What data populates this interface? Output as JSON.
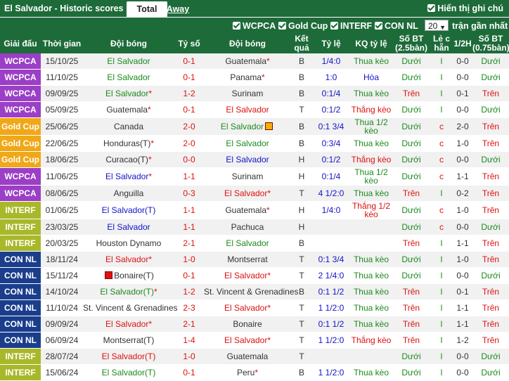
{
  "header": {
    "title": "El Salvador - Historic scores",
    "tab_total": "Total",
    "tab_away": "Away",
    "show_notes": "Hiển thị ghi chú"
  },
  "filters": {
    "items": [
      "WCPCA",
      "Gold Cup",
      "INTERF",
      "CON NL"
    ],
    "count": "20",
    "count_suffix": "trận gần nhất"
  },
  "columns": [
    "Giải đấu",
    "Thời gian",
    "Đội bóng",
    "Tỷ số",
    "Đội bóng",
    "Kết quả",
    "Tỷ lệ",
    "KQ tỷ lệ",
    "Số BT (2.5bàn)",
    "Lẻ c hẵn",
    "1/2H",
    "Số BT (0.75bàn)"
  ],
  "colors": {
    "WCPCA": "#9b3fc6",
    "Gold Cup": "#f0a818",
    "INTERF": "#a9b82a",
    "CON NL": "#1a3e8c",
    "header": "#1e6b3a"
  },
  "rows": [
    {
      "league": "WCPCA",
      "date": "15/10/25",
      "home": "El Salvador",
      "home_c": "green",
      "home_star": "",
      "score": "0-1",
      "away": "Guatemala",
      "away_c": "dark",
      "away_star": "*",
      "res": "B",
      "odds": "1/4:0",
      "kq": "Thua kèo",
      "kq_c": "green",
      "bt": "Dưới",
      "bt_c": "green",
      "lc": "l",
      "lc_c": "green",
      "h": "0-0",
      "bt2": "Dưới",
      "bt2_c": "green"
    },
    {
      "league": "WCPCA",
      "date": "11/10/25",
      "home": "El Salvador",
      "home_c": "green",
      "home_star": "",
      "score": "0-1",
      "away": "Panama",
      "away_c": "dark",
      "away_star": "*",
      "res": "B",
      "odds": "1:0",
      "kq": "Hòa",
      "kq_c": "blue",
      "bt": "Dưới",
      "bt_c": "green",
      "lc": "l",
      "lc_c": "green",
      "h": "0-0",
      "bt2": "Dưới",
      "bt2_c": "green"
    },
    {
      "league": "WCPCA",
      "date": "09/09/25",
      "home": "El Salvador",
      "home_c": "green",
      "home_star": "*",
      "score": "1-2",
      "away": "Surinam",
      "away_c": "dark",
      "away_star": "",
      "res": "B",
      "odds": "0:1/4",
      "kq": "Thua kèo",
      "kq_c": "green",
      "bt": "Trên",
      "bt_c": "red",
      "lc": "l",
      "lc_c": "green",
      "h": "0-1",
      "bt2": "Trên",
      "bt2_c": "red"
    },
    {
      "league": "WCPCA",
      "date": "05/09/25",
      "home": "Guatemala",
      "home_c": "dark",
      "home_star": "*",
      "score": "0-1",
      "away": "El Salvador",
      "away_c": "red",
      "away_star": "",
      "res": "T",
      "odds": "0:1/2",
      "kq": "Thắng kèo",
      "kq_c": "red",
      "bt": "Dưới",
      "bt_c": "green",
      "lc": "l",
      "lc_c": "green",
      "h": "0-0",
      "bt2": "Dưới",
      "bt2_c": "green"
    },
    {
      "league": "Gold Cup",
      "date": "25/06/25",
      "home": "Canada",
      "home_c": "dark",
      "home_star": "",
      "score": "2-0",
      "away": "El Salvador",
      "away_c": "green",
      "away_star": "",
      "away_flag": true,
      "res": "B",
      "odds": "0:1 3/4",
      "kq": "Thua 1/2 kèo",
      "kq_c": "green",
      "bt": "Dưới",
      "bt_c": "green",
      "lc": "c",
      "lc_c": "red",
      "h": "2-0",
      "bt2": "Trên",
      "bt2_c": "red"
    },
    {
      "league": "Gold Cup",
      "date": "22/06/25",
      "home": "Honduras(T)",
      "home_c": "dark",
      "home_star": "*",
      "score": "2-0",
      "away": "El Salvador",
      "away_c": "green",
      "away_star": "",
      "res": "B",
      "odds": "0:3/4",
      "kq": "Thua kèo",
      "kq_c": "green",
      "bt": "Dưới",
      "bt_c": "green",
      "lc": "c",
      "lc_c": "red",
      "h": "1-0",
      "bt2": "Trên",
      "bt2_c": "red"
    },
    {
      "league": "Gold Cup",
      "date": "18/06/25",
      "home": "Curacao(T)",
      "home_c": "dark",
      "home_star": "*",
      "score": "0-0",
      "away": "El Salvador",
      "away_c": "blue",
      "away_star": "",
      "res": "H",
      "odds": "0:1/2",
      "kq": "Thắng kèo",
      "kq_c": "red",
      "bt": "Dưới",
      "bt_c": "green",
      "lc": "c",
      "lc_c": "red",
      "h": "0-0",
      "bt2": "Dưới",
      "bt2_c": "green"
    },
    {
      "league": "WCPCA",
      "date": "11/06/25",
      "home": "El Salvador",
      "home_c": "blue",
      "home_star": "*",
      "score": "1-1",
      "away": "Surinam",
      "away_c": "dark",
      "away_star": "",
      "res": "H",
      "odds": "0:1/4",
      "kq": "Thua 1/2 kèo",
      "kq_c": "green",
      "bt": "Dưới",
      "bt_c": "green",
      "lc": "c",
      "lc_c": "red",
      "h": "1-1",
      "bt2": "Trên",
      "bt2_c": "red"
    },
    {
      "league": "WCPCA",
      "date": "08/06/25",
      "home": "Anguilla",
      "home_c": "dark",
      "home_star": "",
      "score": "0-3",
      "away": "El Salvador",
      "away_c": "red",
      "away_star": "*",
      "res": "T",
      "odds": "4 1/2:0",
      "kq": "Thua kèo",
      "kq_c": "green",
      "bt": "Trên",
      "bt_c": "red",
      "lc": "l",
      "lc_c": "green",
      "h": "0-2",
      "bt2": "Trên",
      "bt2_c": "red"
    },
    {
      "league": "INTERF",
      "date": "01/06/25",
      "home": "El Salvador(T)",
      "home_c": "blue",
      "home_star": "",
      "score": "1-1",
      "away": "Guatemala",
      "away_c": "dark",
      "away_star": "*",
      "res": "H",
      "odds": "1/4:0",
      "kq": "Thắng 1/2 kèo",
      "kq_c": "red",
      "bt": "Dưới",
      "bt_c": "green",
      "lc": "c",
      "lc_c": "red",
      "h": "1-0",
      "bt2": "Trên",
      "bt2_c": "red"
    },
    {
      "league": "INTERF",
      "date": "23/03/25",
      "home": "El Salvador",
      "home_c": "blue",
      "home_star": "",
      "score": "1-1",
      "away": "Pachuca",
      "away_c": "dark",
      "away_star": "",
      "res": "H",
      "odds": "",
      "kq": "",
      "kq_c": "dark",
      "bt": "Dưới",
      "bt_c": "green",
      "lc": "c",
      "lc_c": "red",
      "h": "0-0",
      "bt2": "Dưới",
      "bt2_c": "green"
    },
    {
      "league": "INTERF",
      "date": "20/03/25",
      "home": "Houston Dynamo",
      "home_c": "dark",
      "home_star": "",
      "score": "2-1",
      "away": "El Salvador",
      "away_c": "green",
      "away_star": "",
      "res": "B",
      "odds": "",
      "kq": "",
      "kq_c": "dark",
      "bt": "Trên",
      "bt_c": "red",
      "lc": "l",
      "lc_c": "green",
      "h": "1-1",
      "bt2": "Trên",
      "bt2_c": "red"
    },
    {
      "league": "CON NL",
      "date": "18/11/24",
      "home": "El Salvador",
      "home_c": "red",
      "home_star": "*",
      "score": "1-0",
      "away": "Montserrat",
      "away_c": "dark",
      "away_star": "",
      "res": "T",
      "odds": "0:1 3/4",
      "kq": "Thua kèo",
      "kq_c": "green",
      "bt": "Dưới",
      "bt_c": "green",
      "lc": "l",
      "lc_c": "green",
      "h": "1-0",
      "bt2": "Trên",
      "bt2_c": "red"
    },
    {
      "league": "CON NL",
      "date": "15/11/24",
      "home": "Bonaire(T)",
      "home_c": "dark",
      "home_star": "",
      "home_flag": true,
      "score": "0-1",
      "away": "El Salvador",
      "away_c": "red",
      "away_star": "*",
      "res": "T",
      "odds": "2 1/4:0",
      "kq": "Thua kèo",
      "kq_c": "green",
      "bt": "Dưới",
      "bt_c": "green",
      "lc": "l",
      "lc_c": "green",
      "h": "0-0",
      "bt2": "Dưới",
      "bt2_c": "green"
    },
    {
      "league": "CON NL",
      "date": "14/10/24",
      "home": "El Salvador(T)",
      "home_c": "green",
      "home_star": "*",
      "score": "1-2",
      "away": "St. Vincent & Grenadines",
      "away_c": "dark",
      "away_star": "",
      "res": "B",
      "odds": "0:1 1/2",
      "kq": "Thua kèo",
      "kq_c": "green",
      "bt": "Trên",
      "bt_c": "red",
      "lc": "l",
      "lc_c": "green",
      "h": "0-1",
      "bt2": "Trên",
      "bt2_c": "red"
    },
    {
      "league": "CON NL",
      "date": "11/10/24",
      "home": "St. Vincent & Grenadines",
      "home_c": "dark",
      "home_star": "",
      "score": "2-3",
      "away": "El Salvador",
      "away_c": "red",
      "away_star": "*",
      "res": "T",
      "odds": "1 1/2:0",
      "kq": "Thua kèo",
      "kq_c": "green",
      "bt": "Trên",
      "bt_c": "red",
      "lc": "l",
      "lc_c": "green",
      "h": "1-1",
      "bt2": "Trên",
      "bt2_c": "red"
    },
    {
      "league": "CON NL",
      "date": "09/09/24",
      "home": "El Salvador",
      "home_c": "red",
      "home_star": "*",
      "score": "2-1",
      "away": "Bonaire",
      "away_c": "dark",
      "away_star": "",
      "res": "T",
      "odds": "0:1 1/2",
      "kq": "Thua kèo",
      "kq_c": "green",
      "bt": "Trên",
      "bt_c": "red",
      "lc": "l",
      "lc_c": "green",
      "h": "1-1",
      "bt2": "Trên",
      "bt2_c": "red"
    },
    {
      "league": "CON NL",
      "date": "06/09/24",
      "home": "Montserrat(T)",
      "home_c": "dark",
      "home_star": "",
      "score": "1-4",
      "away": "El Salvador",
      "away_c": "red",
      "away_star": "*",
      "res": "T",
      "odds": "1 1/2:0",
      "kq": "Thắng kèo",
      "kq_c": "red",
      "bt": "Trên",
      "bt_c": "red",
      "lc": "l",
      "lc_c": "green",
      "h": "1-2",
      "bt2": "Trên",
      "bt2_c": "red"
    },
    {
      "league": "INTERF",
      "date": "28/07/24",
      "home": "El Salvador(T)",
      "home_c": "red",
      "home_star": "",
      "score": "1-0",
      "away": "Guatemala",
      "away_c": "dark",
      "away_star": "",
      "res": "T",
      "odds": "",
      "kq": "",
      "kq_c": "dark",
      "bt": "Dưới",
      "bt_c": "green",
      "lc": "l",
      "lc_c": "green",
      "h": "0-0",
      "bt2": "Dưới",
      "bt2_c": "green"
    },
    {
      "league": "INTERF",
      "date": "15/06/24",
      "home": "El Salvador(T)",
      "home_c": "green",
      "home_star": "",
      "score": "0-1",
      "away": "Peru",
      "away_c": "dark",
      "away_star": "*",
      "res": "B",
      "odds": "1 1/2:0",
      "kq": "Thua kèo",
      "kq_c": "green",
      "bt": "Dưới",
      "bt_c": "green",
      "lc": "l",
      "lc_c": "green",
      "h": "0-0",
      "bt2": "Dưới",
      "bt2_c": "green"
    }
  ]
}
